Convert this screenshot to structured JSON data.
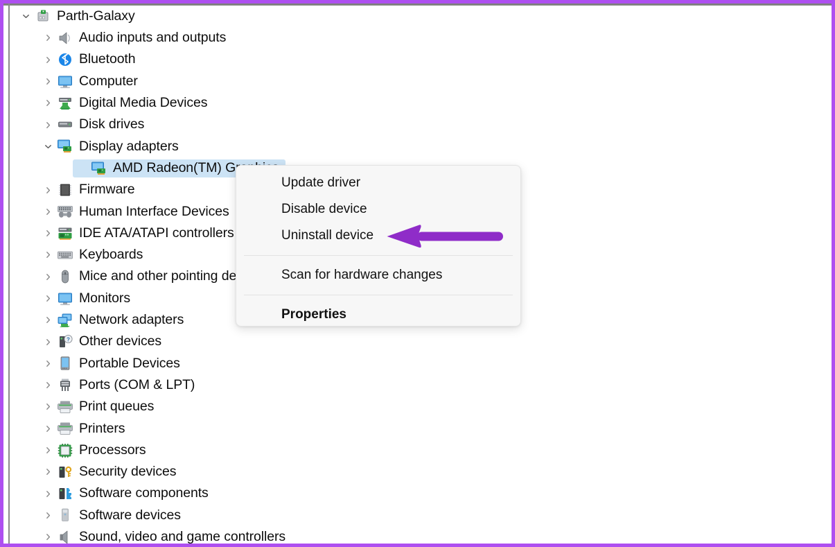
{
  "window": {
    "app": "Device Manager",
    "annotation_arrow_color": "#8f2cc8",
    "frame_color": "#ae4ff0",
    "selection_color": "#cce3f5"
  },
  "tree": {
    "root": {
      "label": "Parth-Galaxy",
      "icon": "computer-host-icon",
      "expanded": true
    },
    "items": [
      {
        "label": "Audio inputs and outputs",
        "icon": "speaker-icon",
        "level": 1,
        "expanded": false
      },
      {
        "label": "Bluetooth",
        "icon": "bluetooth-icon",
        "level": 1,
        "expanded": false
      },
      {
        "label": "Computer",
        "icon": "monitor-icon",
        "level": 1,
        "expanded": false
      },
      {
        "label": "Digital Media Devices",
        "icon": "media-device-icon",
        "level": 1,
        "expanded": false
      },
      {
        "label": "Disk drives",
        "icon": "disk-drive-icon",
        "level": 1,
        "expanded": false
      },
      {
        "label": "Display adapters",
        "icon": "display-adapter-icon",
        "level": 1,
        "expanded": true
      },
      {
        "label": "AMD Radeon(TM) Graphics",
        "icon": "display-adapter-icon",
        "level": 2,
        "expanded": null,
        "selected": true
      },
      {
        "label": "Firmware",
        "icon": "firmware-chip-icon",
        "level": 1,
        "expanded": false
      },
      {
        "label": "Human Interface Devices",
        "icon": "hid-icon",
        "level": 1,
        "expanded": false
      },
      {
        "label": "IDE ATA/ATAPI controllers",
        "icon": "ide-controller-icon",
        "level": 1,
        "expanded": false
      },
      {
        "label": "Keyboards",
        "icon": "keyboard-icon",
        "level": 1,
        "expanded": false
      },
      {
        "label": "Mice and other pointing devices",
        "icon": "mouse-icon",
        "level": 1,
        "expanded": false
      },
      {
        "label": "Monitors",
        "icon": "monitor-icon",
        "level": 1,
        "expanded": false
      },
      {
        "label": "Network adapters",
        "icon": "network-adapter-icon",
        "level": 1,
        "expanded": false
      },
      {
        "label": "Other devices",
        "icon": "unknown-device-icon",
        "level": 1,
        "expanded": false
      },
      {
        "label": "Portable Devices",
        "icon": "portable-device-icon",
        "level": 1,
        "expanded": false
      },
      {
        "label": "Ports (COM & LPT)",
        "icon": "port-icon",
        "level": 1,
        "expanded": false
      },
      {
        "label": "Print queues",
        "icon": "printer-icon",
        "level": 1,
        "expanded": false
      },
      {
        "label": "Printers",
        "icon": "printer-icon",
        "level": 1,
        "expanded": false
      },
      {
        "label": "Processors",
        "icon": "processor-icon",
        "level": 1,
        "expanded": false
      },
      {
        "label": "Security devices",
        "icon": "security-device-icon",
        "level": 1,
        "expanded": false
      },
      {
        "label": "Software components",
        "icon": "software-component-icon",
        "level": 1,
        "expanded": false
      },
      {
        "label": "Software devices",
        "icon": "software-device-icon",
        "level": 1,
        "expanded": false
      },
      {
        "label": "Sound, video and game controllers",
        "icon": "sound-controller-icon",
        "level": 1,
        "expanded": false
      }
    ]
  },
  "context_menu": {
    "items": [
      {
        "label": "Update driver",
        "bold": false
      },
      {
        "label": "Disable device",
        "bold": false
      },
      {
        "label": "Uninstall device",
        "bold": false
      },
      {
        "label": "Scan for hardware changes",
        "bold": false
      },
      {
        "label": "Properties",
        "bold": true
      }
    ]
  }
}
